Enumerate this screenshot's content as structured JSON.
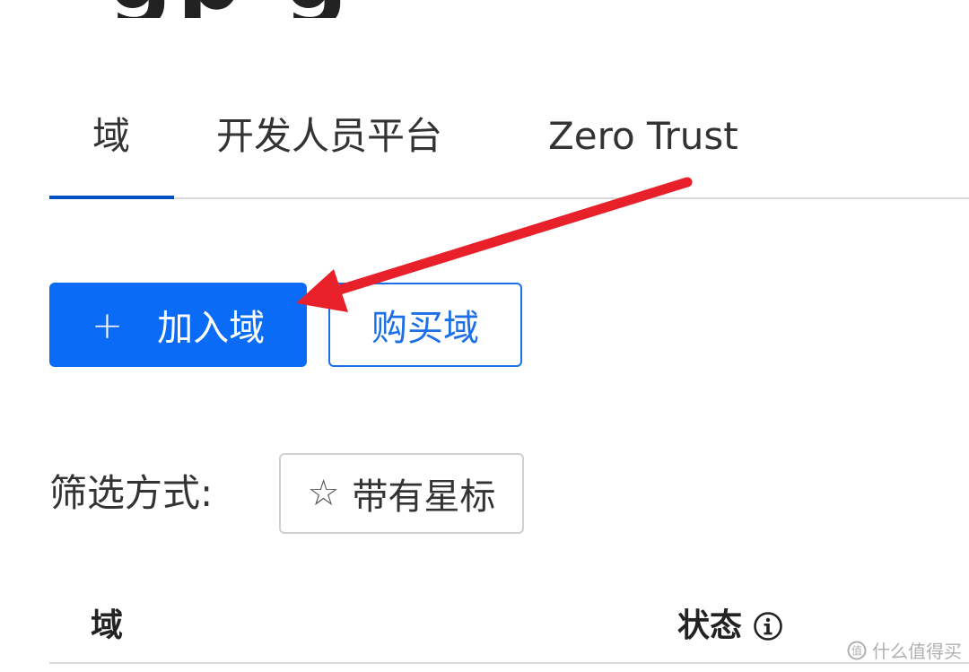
{
  "tabs": [
    {
      "label": "域",
      "active": true
    },
    {
      "label": "开发人员平台",
      "active": false
    },
    {
      "label": "Zero Trust",
      "active": false
    }
  ],
  "actions": {
    "add_icon": "plus-icon",
    "add_label": "加入域",
    "buy_label": "购买域"
  },
  "filter": {
    "label": "筛选方式:",
    "chip_icon": "star-outline-icon",
    "chip_label": "带有星标"
  },
  "table": {
    "columns": [
      "域",
      "状态"
    ],
    "status_icon": "info-circle-icon"
  },
  "watermark": {
    "text": "什么值得买"
  },
  "colors": {
    "primary": "#0a6cf6",
    "tab_indicator": "#0051c3",
    "annotation_arrow": "#e8202a"
  }
}
